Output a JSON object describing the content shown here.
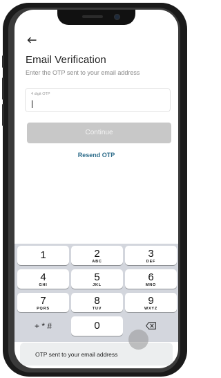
{
  "header": {
    "back_icon": "arrow-left-icon",
    "title": "Email Verification",
    "subtitle": "Enter the OTP sent to your email address"
  },
  "otp_field": {
    "label": "4 digit OTP",
    "value": ""
  },
  "actions": {
    "continue_label": "Continue",
    "resend_label": "Resend OTP"
  },
  "keyboard": {
    "keys": [
      {
        "num": "1",
        "letters": ""
      },
      {
        "num": "2",
        "letters": "ABC"
      },
      {
        "num": "3",
        "letters": "DEF"
      },
      {
        "num": "4",
        "letters": "GHI"
      },
      {
        "num": "5",
        "letters": "JKL"
      },
      {
        "num": "6",
        "letters": "MNO"
      },
      {
        "num": "7",
        "letters": "PQRS"
      },
      {
        "num": "8",
        "letters": "TUV"
      },
      {
        "num": "9",
        "letters": "WXYZ"
      },
      {
        "num": "0",
        "letters": ""
      }
    ],
    "symbols_label": "+ * #",
    "backspace_icon": "backspace-icon"
  },
  "toast": {
    "message": "OTP sent to your email address"
  }
}
